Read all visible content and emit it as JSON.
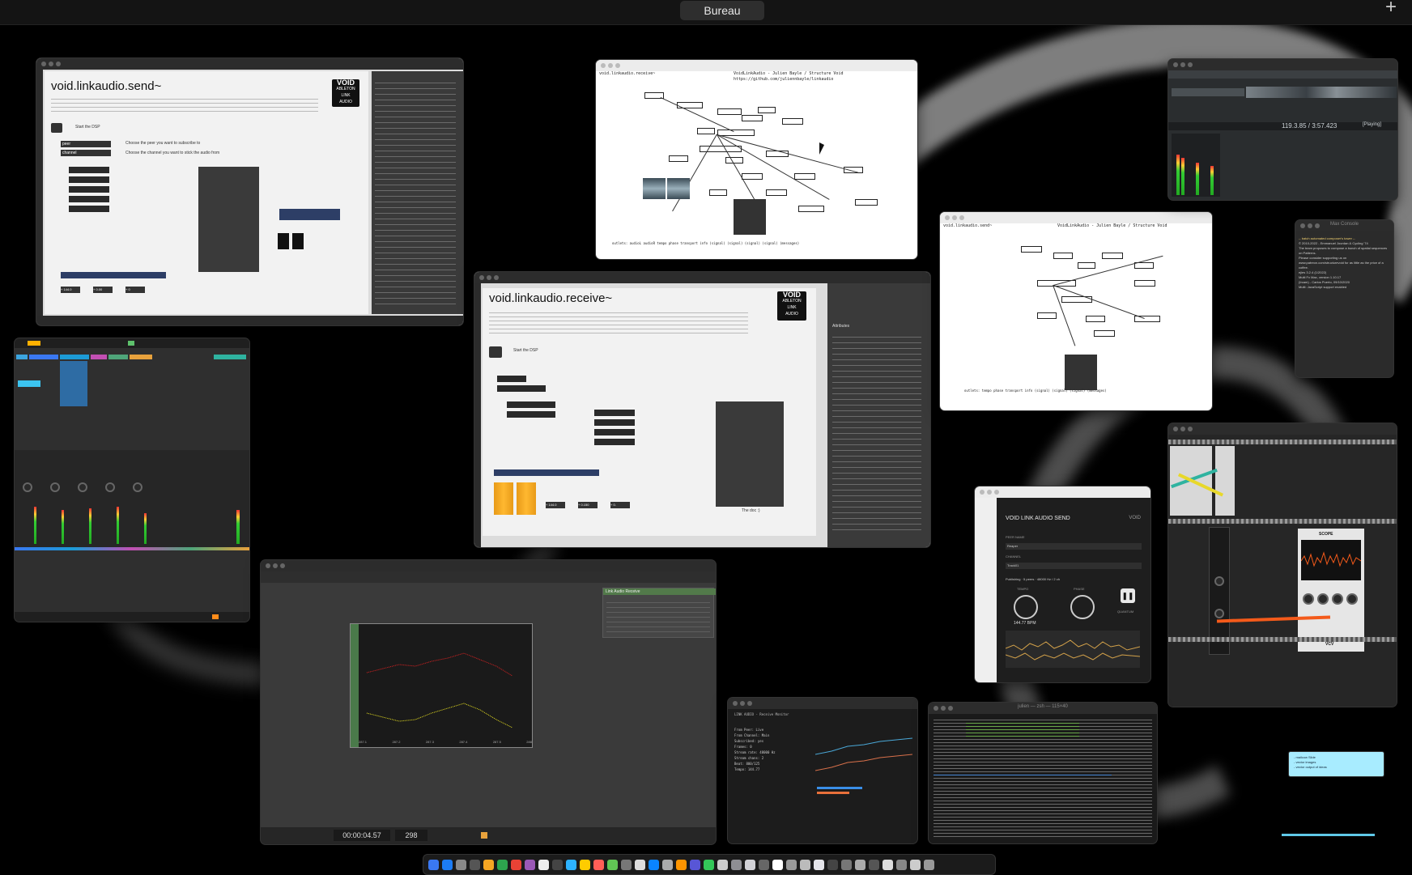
{
  "desktop": {
    "space_name": "Bureau",
    "add_space_symbol": "+"
  },
  "windows": {
    "send_help": {
      "title": "void.linkaudio.send~",
      "logo": [
        "VOID",
        "ABLETON",
        "LINK",
        "AUDIO"
      ],
      "start_dsp": "Start the DSP",
      "step1": "Choose the peer you want to subscribe to",
      "step2": "Choose the channel you want to stick the audio from",
      "peer": "peer",
      "channel": "channel",
      "values": [
        "+ 144.0",
        "+ 0.00",
        "+ 0"
      ]
    },
    "receive_help": {
      "title": "void.linkaudio.receive~",
      "logo": [
        "VOID",
        "ABLETON",
        "LINK",
        "AUDIO"
      ],
      "start_dsp": "Start the DSP",
      "attributes_label": "Attributes",
      "values": [
        "+ 144.0",
        "+ 0.150",
        "+ 0."
      ],
      "the_doc": "The doc :)"
    },
    "patch_top": {
      "title_left": "void.linkaudio.receive~",
      "title_right": "VoidLinkAudio - Julien Bayle / Structure Void",
      "url": "https://github.com/juliennbayle/linkaudio",
      "outlets_text": "outlets: audioL audioR tempo phase transport info (signal) (signal) (signal) (signal) (messages)"
    },
    "patch_right": {
      "title_left": "void.linkaudio.send~",
      "title_right": "VoidLinkAudio - Julien Bayle / Structure Void",
      "outlets_text": "outlets: tempo phase transport info (signal) (signal) (signal) (messages)"
    },
    "vst": {
      "title": "VOID LINK AUDIO SEND",
      "brand": "VOID",
      "peer_label": "PEER NAME",
      "peer_value": "Reaper",
      "channel_label": "CHANNEL",
      "channel_value": "Track01",
      "status": "Publishing · 5 peers · 48000 Hz / 2 ch",
      "tempo_label": "TEMPO",
      "phase_label": "PHASE",
      "quantum_label": "QUANTUM",
      "bpm": "144.77 BPM"
    },
    "reaper": {
      "time_display": "119.3.85 / 3:57.423",
      "status": "[Playing]"
    },
    "touch": {
      "timecode": "00:00:04.57",
      "frame": "298",
      "panel_title": "Link Audio Receive",
      "chart_ticks": [
        "287.1",
        "287.2",
        "287.3",
        "287.4",
        "287.5",
        "288"
      ]
    },
    "terminal_stats": {
      "title": "LINK AUDIO - Receive Monitor",
      "lines": [
        "From Peer:   Live",
        "From Channel: Main",
        "Subscribed:   yes",
        "Frames:       0",
        "",
        "Stream rate:  48000 Hz",
        "Stream chans: 2",
        "",
        "Beat:    800/125",
        "Tempo:   144.77"
      ]
    },
    "terminal_git": {
      "title": "julien — zsh — 115×40"
    },
    "chat": {
      "title": "Max Console",
      "lines": [
        "-- batch automated composer's tower --",
        "© 2010-2022 - Emmanuel Jourdan & Cycling '74",
        "The team proposes to compose a bunch of spatial sequences on Patterns.",
        "Please consider supporting us on",
        "www.patreon.com/structurevoid for as little as the price of a coffee.",
        "ejies 3.2.4 (1/2022)",
        "Multi Fx Max, version 1.10.17",
        "(Ircam) - Carlos Puerto, 09/10/2020",
        "Multi: JavaScript support enabled"
      ]
    },
    "sticky": {
      "lines": [
        "- mailcow Slide",
        "- vector images",
        "- vector output of ideas"
      ]
    },
    "vcv": {
      "module_title": "SCOPE",
      "brand": "VCV"
    }
  },
  "dock": {
    "icon_colors": [
      "#3a78f2",
      "#1c7cf4",
      "#888888",
      "#555555",
      "#f5a623",
      "#2da44e",
      "#e94235",
      "#9b59b6",
      "#eeeeee",
      "#444444",
      "#2db3ff",
      "#ffcc00",
      "#ff5f57",
      "#61c554",
      "#777777",
      "#dddddd",
      "#0a84ff",
      "#aaaaaa",
      "#ff9500",
      "#5856d6",
      "#34c759",
      "#cccccc",
      "#8e8e93",
      "#d1d1d6",
      "#666666",
      "#ffffff",
      "#999999",
      "#bbbbbb",
      "#e5e5ea",
      "#444444",
      "#777777",
      "#aaaaaa",
      "#555555",
      "#dddddd",
      "#888888",
      "#cccccc",
      "#999999"
    ]
  }
}
